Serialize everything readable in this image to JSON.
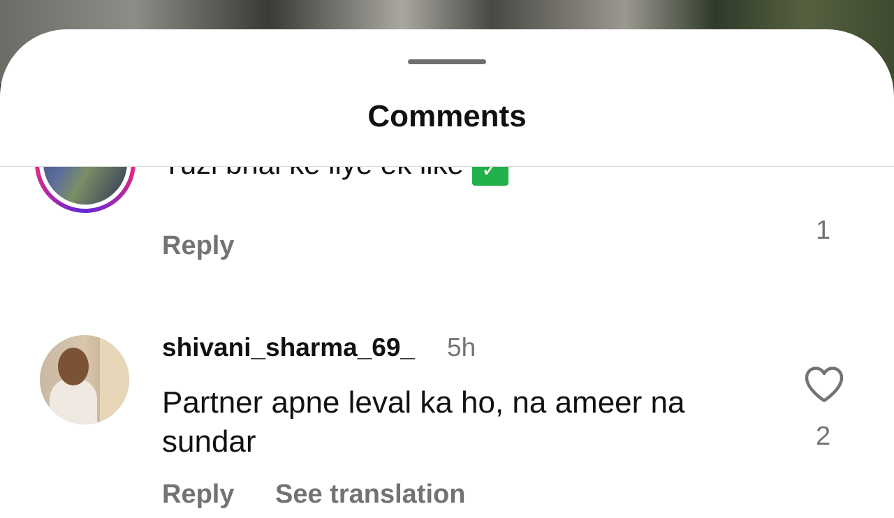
{
  "header": {
    "title": "Comments"
  },
  "comments": [
    {
      "text_partial": "Yuzi bhai ke liye ek like",
      "emoji_name": "check-mark-emoji",
      "reply_label": "Reply",
      "like_count": "1"
    },
    {
      "username": "shivani_sharma_69_",
      "time": "5h",
      "text": "Partner apne leval ka ho, na ameer na sundar",
      "reply_label": "Reply",
      "translate_label": "See translation",
      "like_count": "2",
      "like_icon": "heart-outline-icon"
    }
  ],
  "colors": {
    "sheet_bg": "#ffffff",
    "primary_text": "#111111",
    "secondary_text": "#737373"
  }
}
